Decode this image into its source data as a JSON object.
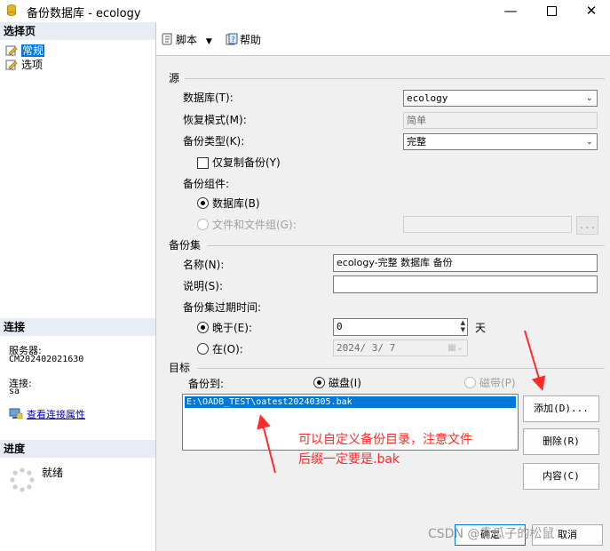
{
  "window": {
    "title": "备份数据库 - ecology",
    "minimize_icon": "minimize-icon",
    "maximize_icon": "maximize-icon",
    "close_icon": "close-icon"
  },
  "left_pane": {
    "select_page_header": "选择页",
    "pages": [
      {
        "label": "常规",
        "icon": "page-icon",
        "selected": true
      },
      {
        "label": "选项",
        "icon": "page-icon",
        "selected": false
      }
    ],
    "connection_header": "连接",
    "server_label": "服务器:",
    "server_value": "CM202402021630",
    "connection_label": "连接:",
    "connection_value": "sa",
    "view_connection_link": "查看连接属性",
    "progress_header": "进度",
    "progress_status": "就绪"
  },
  "toolbar": {
    "script_label": "脚本",
    "help_label": "帮助"
  },
  "source": {
    "group_label": "源",
    "database_label": "数据库(T):",
    "database_value": "ecology",
    "recovery_label": "恢复模式(M):",
    "recovery_value": "简单",
    "backup_type_label": "备份类型(K):",
    "backup_type_value": "完整",
    "copy_only_label": "仅复制备份(Y)",
    "component_label": "备份组件:",
    "component_database_label": "数据库(B)",
    "component_files_label": "文件和文件组(G):",
    "ellipsis_label": "..."
  },
  "backup_set": {
    "group_label": "备份集",
    "name_label": "名称(N):",
    "name_value": "ecology-完整 数据库 备份",
    "description_label": "说明(S):",
    "description_value": "",
    "expire_label": "备份集过期时间:",
    "after_label": "晚于(E):",
    "after_value": "0",
    "days_label": "天",
    "on_label": "在(O):",
    "on_value": "2024/ 3/ 7"
  },
  "destination": {
    "group_label": "目标",
    "backup_to_label": "备份到:",
    "disk_label": "磁盘(I)",
    "tape_label": "磁带(P)",
    "paths": [
      "E:\\OADB_TEST\\oatest20240305.bak"
    ],
    "add_button": "添加(D)...",
    "remove_button": "删除(R)",
    "contents_button": "内容(C)",
    "annotation_line1": "可以自定义备份目录，注意文件",
    "annotation_line2": "后缀一定要是.bak"
  },
  "footer": {
    "ok_button": "确定",
    "cancel_button": "取消",
    "watermark": "CSDN @青瓜子的松鼠"
  },
  "colors": {
    "selection": "#0078d7",
    "annotation": "#ff2a2a",
    "panel": "#f0f0f0",
    "link": "#0000cc"
  }
}
